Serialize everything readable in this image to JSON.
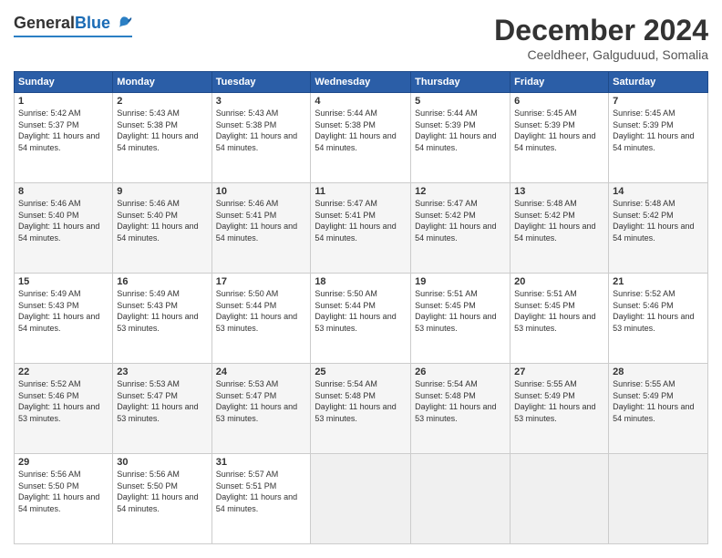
{
  "logo": {
    "general": "General",
    "blue": "Blue"
  },
  "header": {
    "month_title": "December 2024",
    "location": "Ceeldheer, Galguduud, Somalia"
  },
  "weekdays": [
    "Sunday",
    "Monday",
    "Tuesday",
    "Wednesday",
    "Thursday",
    "Friday",
    "Saturday"
  ],
  "weeks": [
    [
      {
        "day": "1",
        "sunrise": "5:42 AM",
        "sunset": "5:37 PM",
        "daylight": "11 hours and 54 minutes."
      },
      {
        "day": "2",
        "sunrise": "5:43 AM",
        "sunset": "5:38 PM",
        "daylight": "11 hours and 54 minutes."
      },
      {
        "day": "3",
        "sunrise": "5:43 AM",
        "sunset": "5:38 PM",
        "daylight": "11 hours and 54 minutes."
      },
      {
        "day": "4",
        "sunrise": "5:44 AM",
        "sunset": "5:38 PM",
        "daylight": "11 hours and 54 minutes."
      },
      {
        "day": "5",
        "sunrise": "5:44 AM",
        "sunset": "5:39 PM",
        "daylight": "11 hours and 54 minutes."
      },
      {
        "day": "6",
        "sunrise": "5:45 AM",
        "sunset": "5:39 PM",
        "daylight": "11 hours and 54 minutes."
      },
      {
        "day": "7",
        "sunrise": "5:45 AM",
        "sunset": "5:39 PM",
        "daylight": "11 hours and 54 minutes."
      }
    ],
    [
      {
        "day": "8",
        "sunrise": "5:46 AM",
        "sunset": "5:40 PM",
        "daylight": "11 hours and 54 minutes."
      },
      {
        "day": "9",
        "sunrise": "5:46 AM",
        "sunset": "5:40 PM",
        "daylight": "11 hours and 54 minutes."
      },
      {
        "day": "10",
        "sunrise": "5:46 AM",
        "sunset": "5:41 PM",
        "daylight": "11 hours and 54 minutes."
      },
      {
        "day": "11",
        "sunrise": "5:47 AM",
        "sunset": "5:41 PM",
        "daylight": "11 hours and 54 minutes."
      },
      {
        "day": "12",
        "sunrise": "5:47 AM",
        "sunset": "5:42 PM",
        "daylight": "11 hours and 54 minutes."
      },
      {
        "day": "13",
        "sunrise": "5:48 AM",
        "sunset": "5:42 PM",
        "daylight": "11 hours and 54 minutes."
      },
      {
        "day": "14",
        "sunrise": "5:48 AM",
        "sunset": "5:42 PM",
        "daylight": "11 hours and 54 minutes."
      }
    ],
    [
      {
        "day": "15",
        "sunrise": "5:49 AM",
        "sunset": "5:43 PM",
        "daylight": "11 hours and 54 minutes."
      },
      {
        "day": "16",
        "sunrise": "5:49 AM",
        "sunset": "5:43 PM",
        "daylight": "11 hours and 53 minutes."
      },
      {
        "day": "17",
        "sunrise": "5:50 AM",
        "sunset": "5:44 PM",
        "daylight": "11 hours and 53 minutes."
      },
      {
        "day": "18",
        "sunrise": "5:50 AM",
        "sunset": "5:44 PM",
        "daylight": "11 hours and 53 minutes."
      },
      {
        "day": "19",
        "sunrise": "5:51 AM",
        "sunset": "5:45 PM",
        "daylight": "11 hours and 53 minutes."
      },
      {
        "day": "20",
        "sunrise": "5:51 AM",
        "sunset": "5:45 PM",
        "daylight": "11 hours and 53 minutes."
      },
      {
        "day": "21",
        "sunrise": "5:52 AM",
        "sunset": "5:46 PM",
        "daylight": "11 hours and 53 minutes."
      }
    ],
    [
      {
        "day": "22",
        "sunrise": "5:52 AM",
        "sunset": "5:46 PM",
        "daylight": "11 hours and 53 minutes."
      },
      {
        "day": "23",
        "sunrise": "5:53 AM",
        "sunset": "5:47 PM",
        "daylight": "11 hours and 53 minutes."
      },
      {
        "day": "24",
        "sunrise": "5:53 AM",
        "sunset": "5:47 PM",
        "daylight": "11 hours and 53 minutes."
      },
      {
        "day": "25",
        "sunrise": "5:54 AM",
        "sunset": "5:48 PM",
        "daylight": "11 hours and 53 minutes."
      },
      {
        "day": "26",
        "sunrise": "5:54 AM",
        "sunset": "5:48 PM",
        "daylight": "11 hours and 53 minutes."
      },
      {
        "day": "27",
        "sunrise": "5:55 AM",
        "sunset": "5:49 PM",
        "daylight": "11 hours and 53 minutes."
      },
      {
        "day": "28",
        "sunrise": "5:55 AM",
        "sunset": "5:49 PM",
        "daylight": "11 hours and 54 minutes."
      }
    ],
    [
      {
        "day": "29",
        "sunrise": "5:56 AM",
        "sunset": "5:50 PM",
        "daylight": "11 hours and 54 minutes."
      },
      {
        "day": "30",
        "sunrise": "5:56 AM",
        "sunset": "5:50 PM",
        "daylight": "11 hours and 54 minutes."
      },
      {
        "day": "31",
        "sunrise": "5:57 AM",
        "sunset": "5:51 PM",
        "daylight": "11 hours and 54 minutes."
      },
      null,
      null,
      null,
      null
    ]
  ]
}
